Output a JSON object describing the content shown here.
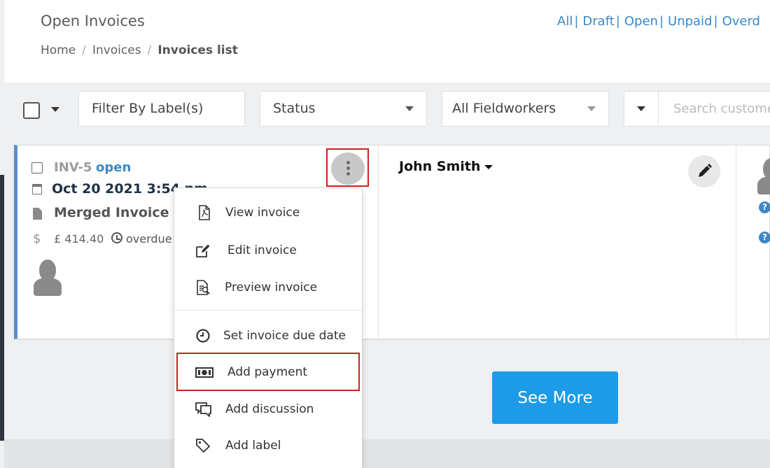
{
  "header": {
    "title": "Open Invoices",
    "breadcrumb": [
      "Home",
      "Invoices",
      "Invoices list"
    ],
    "breadcrumb_sep": "/",
    "status_links": [
      "All",
      "Draft",
      "Open",
      "Unpaid",
      "Overd"
    ]
  },
  "filters": {
    "label_filter": "Filter By Label(s)",
    "status_filter": "Status",
    "fieldworkers_filter": "All Fieldworkers",
    "search_placeholder": "Search custome"
  },
  "invoice": {
    "number": "INV-5",
    "status": "open",
    "date": "Oct 20 2021 3:54 pm",
    "type": "Merged Invoice",
    "currency_symbol": "$",
    "amount": "£ 414.40",
    "due_status": "overdue",
    "customer": "John Smith"
  },
  "menu": {
    "items": [
      {
        "label": "View invoice",
        "icon": "pdf-file-icon"
      },
      {
        "label": "Edit invoice",
        "icon": "edit-icon"
      },
      {
        "label": "Preview invoice",
        "icon": "preview-icon"
      },
      {
        "label": "Set invoice due date",
        "icon": "clock-icon"
      },
      {
        "label": "Add payment",
        "icon": "money-icon"
      },
      {
        "label": "Add discussion",
        "icon": "discussion-icon"
      },
      {
        "label": "Add label",
        "icon": "tag-icon"
      }
    ]
  },
  "see_more": "See More",
  "colors": {
    "accent": "#3b88c8",
    "button": "#1d9be8",
    "highlight": "#d02020"
  }
}
